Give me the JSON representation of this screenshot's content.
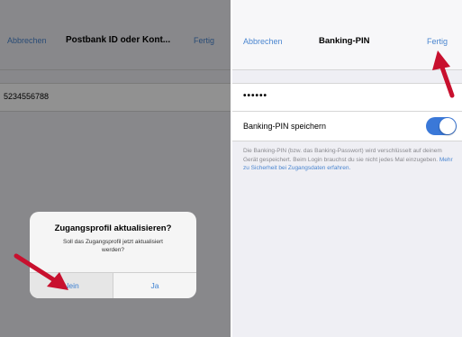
{
  "left": {
    "nav": {
      "cancel": "Abbrechen",
      "title": "Postbank ID oder Kont...",
      "done": "Fertig"
    },
    "field_value": "5234556788",
    "alert": {
      "title": "Zugangsprofil aktualisieren?",
      "message": "Soll das Zugangsprofil jetzt aktualisiert werden?",
      "no": "Nein",
      "yes": "Ja"
    }
  },
  "right": {
    "nav": {
      "cancel": "Abbrechen",
      "title": "Banking-PIN",
      "done": "Fertig"
    },
    "pin_value": "••••••",
    "save_label": "Banking-PIN speichern",
    "save_toggle_on": true,
    "hint_text": "Die Banking-PIN (bzw. das Banking-Passwort) wird verschlüsselt auf deinem Gerät gespeichert. Beim Login brauchst du sie nicht jedes Mal einzugeben.",
    "hint_link": "Mehr zu Sicherheit bei Zugangsdaten erfahren."
  },
  "colors": {
    "accent": "#3a78d8",
    "annotation_arrow": "#c8102e"
  }
}
